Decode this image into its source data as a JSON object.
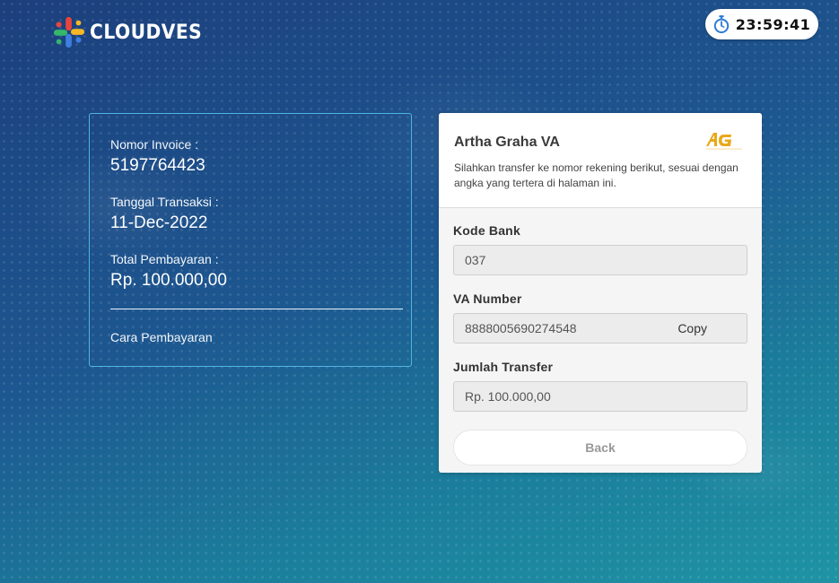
{
  "brand": {
    "name": "CLOUDVES",
    "colors": {
      "red": "#e8453c",
      "yellow": "#f6b827",
      "green": "#33b86a",
      "blue": "#3d7fe0"
    }
  },
  "timer": {
    "icon": "stopwatch-icon",
    "value": "23:59:41"
  },
  "invoice": {
    "invoice_number_label": "Nomor Invoice :",
    "invoice_number": "5197764423",
    "transaction_date_label": "Tanggal Transaksi :",
    "transaction_date": "11-Dec-2022",
    "total_label": "Total Pembayaran :",
    "total": "Rp. 100.000,00",
    "how_to_pay": "Cara Pembayaran"
  },
  "payment": {
    "title": "Artha Graha VA",
    "bank_logo": "bank-artha-graha-logo",
    "description": "Silahkan transfer ke nomor rekening berikut, sesuai dengan angka yang tertera di halaman ini.",
    "bank_code_label": "Kode Bank",
    "bank_code": "037",
    "va_number_label": "VA Number",
    "va_number": "8888005690274548",
    "copy_label": "Copy",
    "amount_label": "Jumlah Transfer",
    "amount": "Rp. 100.000,00",
    "back_label": "Back",
    "accent": "#e8a91b"
  }
}
